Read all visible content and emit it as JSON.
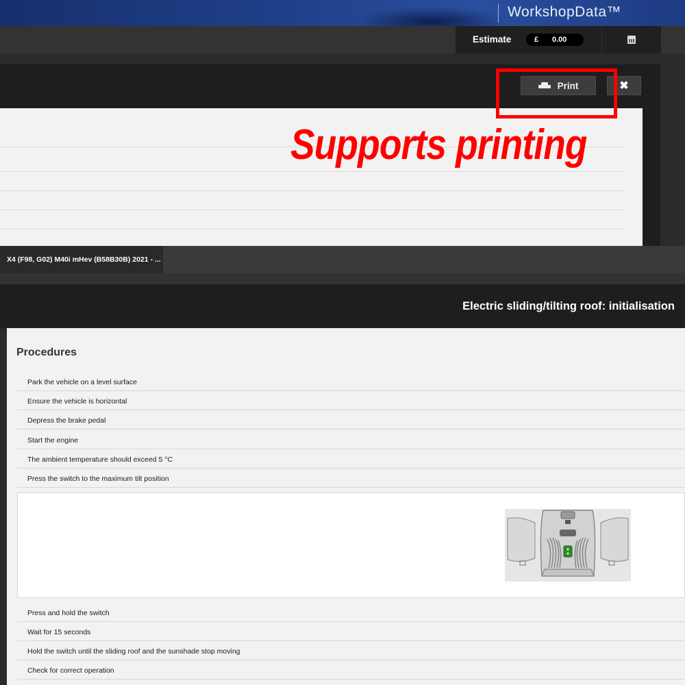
{
  "brand": {
    "name": "WorkshopData™"
  },
  "estimate": {
    "label": "Estimate",
    "currency": "£",
    "value": "0.00"
  },
  "icons": {
    "calculator": "calculator-icon",
    "printer": "printer-icon",
    "close": "close-icon"
  },
  "print_dialog": {
    "print_label": "Print",
    "close_label": "✖"
  },
  "promo": {
    "text": "Supports printing",
    "color": "#ff0000"
  },
  "breadcrumb": {
    "vehicle": "X4 (F98, G02) M40i mHev (B58B30B) 2021 - ..."
  },
  "document": {
    "title": "Electric sliding/tilting roof: initialisation",
    "section": "Procedures",
    "steps_before_figure": [
      "Park the vehicle on a level surface",
      "Ensure the vehicle is horizontal",
      "Depress the brake pedal",
      "Start the engine",
      "The ambient temperature should exceed 5 °C",
      "Press the switch to the maximum tilt position"
    ],
    "steps_after_figure": [
      "Press and hold the switch",
      "Wait for 15 seconds",
      "Hold the switch until the sliding roof and the sunshade stop moving",
      "Check for correct operation"
    ]
  },
  "colors": {
    "banner": "#1f3f88",
    "highlight": "#ff0000",
    "switch_indicator": "#2e8b2e"
  }
}
